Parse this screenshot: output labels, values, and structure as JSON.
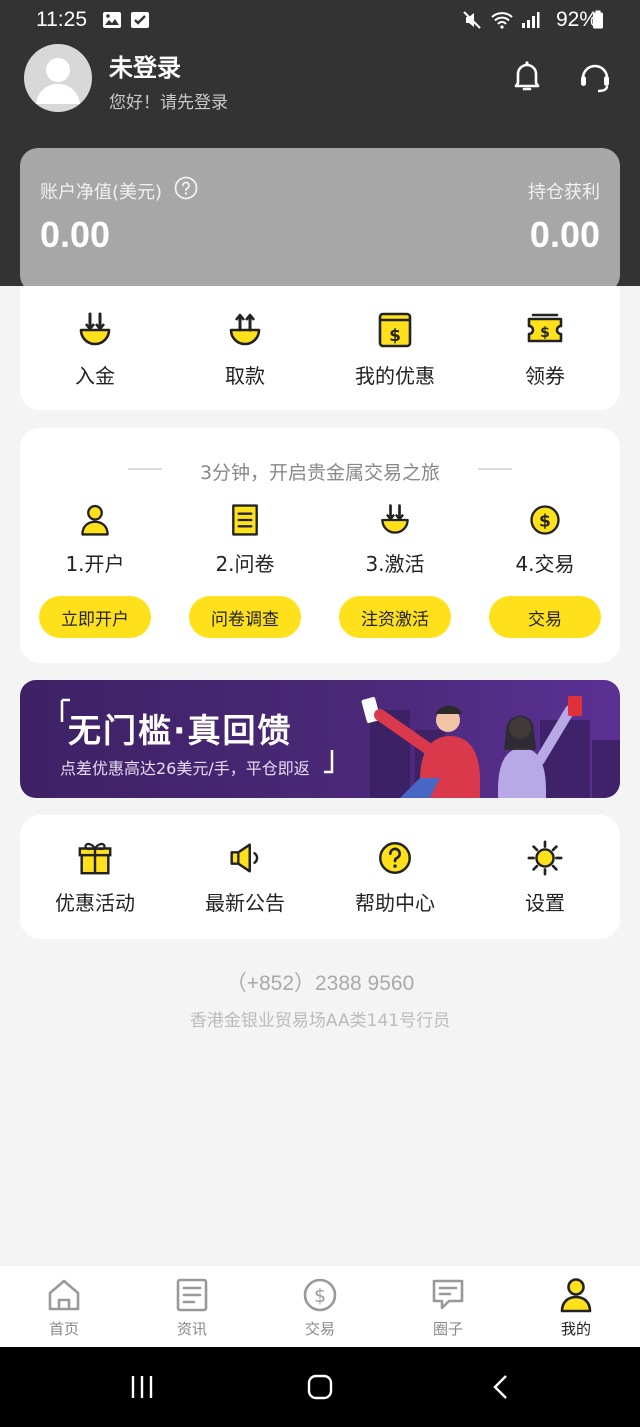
{
  "status_bar": {
    "time": "11:25",
    "battery": "92%"
  },
  "header": {
    "user_name": "未登录",
    "greeting": "您好！请先登录"
  },
  "account": {
    "net_value_label": "账户净值(美元)",
    "net_value": "0.00",
    "profit_label": "持仓获利",
    "profit": "0.00"
  },
  "quick_actions": [
    {
      "label": "入金",
      "icon": "deposit-icon"
    },
    {
      "label": "取款",
      "icon": "withdraw-icon"
    },
    {
      "label": "我的优惠",
      "icon": "coupon-icon"
    },
    {
      "label": "领券",
      "icon": "ticket-icon"
    }
  ],
  "journey": {
    "title": "3分钟，开启贵金属交易之旅",
    "steps": [
      {
        "label": "1.开户",
        "button": "立即开户",
        "icon": "user-icon"
      },
      {
        "label": "2.问卷",
        "button": "问卷调查",
        "icon": "document-icon"
      },
      {
        "label": "3.激活",
        "button": "注资激活",
        "icon": "deposit-icon"
      },
      {
        "label": "4.交易",
        "button": "交易",
        "icon": "dollar-icon"
      }
    ]
  },
  "banner": {
    "title": "无门槛·真回馈",
    "subtitle": "点差优惠高达26美元/手，平仓即返"
  },
  "services": [
    {
      "label": "优惠活动",
      "icon": "gift-icon"
    },
    {
      "label": "最新公告",
      "icon": "megaphone-icon"
    },
    {
      "label": "帮助中心",
      "icon": "help-icon"
    },
    {
      "label": "设置",
      "icon": "settings-icon"
    }
  ],
  "footer": {
    "phone": "（+852）2388 9560",
    "license": "香港金银业贸易场AA类141号行员"
  },
  "tabbar": [
    {
      "label": "首页",
      "icon": "home-icon"
    },
    {
      "label": "资讯",
      "icon": "news-icon"
    },
    {
      "label": "交易",
      "icon": "dollar-icon"
    },
    {
      "label": "圈子",
      "icon": "chat-icon"
    },
    {
      "label": "我的",
      "icon": "user-icon",
      "active": true
    }
  ],
  "colors": {
    "accent": "#FFE11B",
    "dark_header": "#333333",
    "card_gray": "#A7A7A7"
  }
}
